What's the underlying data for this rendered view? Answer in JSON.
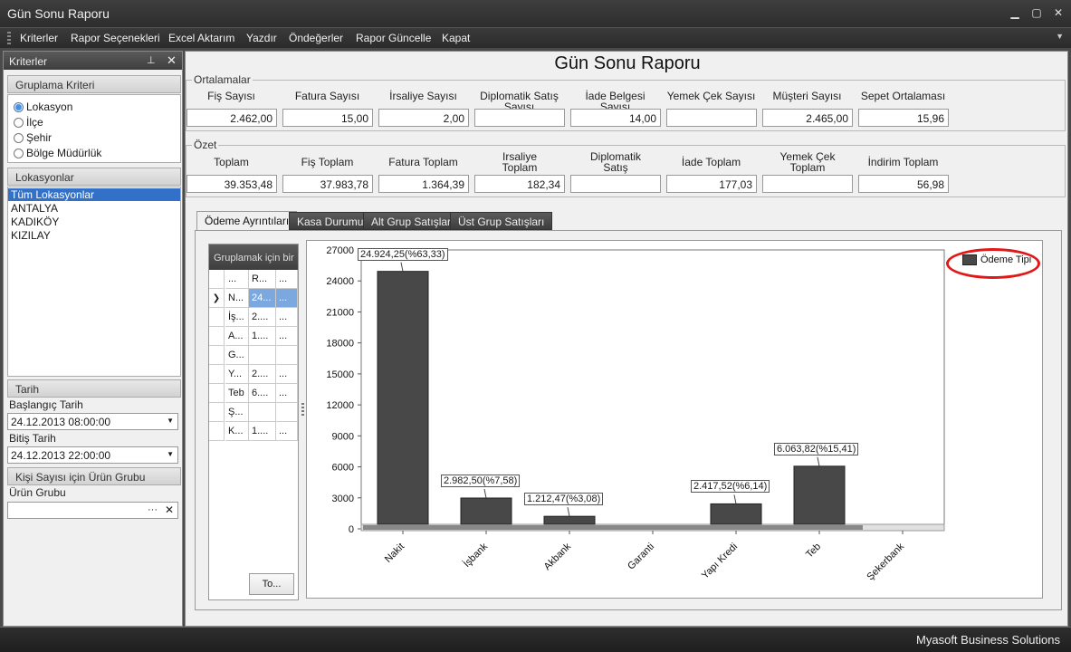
{
  "window": {
    "title": "Gün Sonu Raporu"
  },
  "menu": [
    "Kriterler",
    "Rapor Seçenekleri",
    "Excel Aktarım",
    "Yazdır",
    "Öndeğerler",
    "Rapor Güncelle",
    "Kapat"
  ],
  "left_panel": {
    "header": "Kriterler",
    "grouping": {
      "title": "Gruplama Kriteri",
      "options": [
        "Lokasyon",
        "İlçe",
        "Şehir",
        "Bölge Müdürlük"
      ],
      "selected": "Lokasyon"
    },
    "locations": {
      "title": "Lokasyonlar",
      "items": [
        "Tüm Lokasyonlar",
        "ANTALYA",
        "KADIKÖY",
        "KIZILAY"
      ],
      "selected": "Tüm Lokasyonlar"
    },
    "date": {
      "title": "Tarih",
      "start_label": "Başlangıç Tarih",
      "start_value": "24.12.2013 08:00:00",
      "end_label": "Bitiş Tarih",
      "end_value": "24.12.2013 22:00:00"
    },
    "product_group": {
      "title": "Kişi Sayısı için Ürün Grubu",
      "label": "Ürün Grubu",
      "value": "",
      "ellipsis": "···",
      "clear": "✕"
    }
  },
  "report": {
    "title": "Gün Sonu Raporu",
    "averages": {
      "title": "Ortalamalar",
      "fields": [
        {
          "label": "Fiş Sayısı",
          "value": "2.462,00"
        },
        {
          "label": "Fatura Sayısı",
          "value": "15,00"
        },
        {
          "label": "İrsaliye Sayısı",
          "value": "2,00"
        },
        {
          "label": "Diplomatik Satış Sayısı",
          "value": ""
        },
        {
          "label": "İade Belgesi Sayısı",
          "value": "14,00"
        },
        {
          "label": "Yemek Çek Sayısı",
          "value": ""
        },
        {
          "label": "Müşteri Sayısı",
          "value": "2.465,00"
        },
        {
          "label": "Sepet Ortalaması",
          "value": "15,96"
        }
      ]
    },
    "summary": {
      "title": "Özet",
      "fields": [
        {
          "label": "Toplam",
          "value": "39.353,48"
        },
        {
          "label": "Fiş Toplam",
          "value": "37.983,78"
        },
        {
          "label": "Fatura Toplam",
          "value": "1.364,39"
        },
        {
          "label": "Irsaliye Toplam",
          "value": "182,34"
        },
        {
          "label": "Diplomatik Satış",
          "value": ""
        },
        {
          "label": "İade Toplam",
          "value": "177,03"
        },
        {
          "label": "Yemek Çek Toplam",
          "value": ""
        },
        {
          "label": "İndirim Toplam",
          "value": "56,98"
        }
      ]
    }
  },
  "tabs": [
    "Ödeme Ayrıntıları",
    "Kasa Durumu",
    "Alt Grup Satışları",
    "Üst Grup Satışları"
  ],
  "active_tab": "Ödeme Ayrıntıları",
  "grid": {
    "group_header": "Gruplamak için bir",
    "columns": [
      "...",
      "R...",
      "..."
    ],
    "rows": [
      [
        "N...",
        "24...",
        "..."
      ],
      [
        "İş...",
        "2....",
        "..."
      ],
      [
        "A...",
        "1....",
        "..."
      ],
      [
        "G...",
        "",
        ""
      ],
      [
        "Y...",
        "2....",
        "..."
      ],
      [
        "Teb",
        "6....",
        "..."
      ],
      [
        "Ş...",
        "",
        ""
      ],
      [
        "K...",
        "1....",
        "..."
      ]
    ],
    "selected_row": 0,
    "footer_button": "To..."
  },
  "chart_data": {
    "type": "bar",
    "categories": [
      "Nakit",
      "İşbank",
      "Akbank",
      "Garanti",
      "Yapı Kredi",
      "Teb",
      "Şekerbank"
    ],
    "series": [
      {
        "name": "Ödeme Tipi",
        "values": [
          24924.25,
          2982.5,
          1212.47,
          0,
          2417.52,
          6063.82,
          0
        ]
      }
    ],
    "data_labels": [
      "24.924,25(%63,33)",
      "2.982,50(%7,58)",
      "1.212,47(%3,08)",
      "",
      "2.417,52(%6,14)",
      "6.063,82(%15,41)",
      ""
    ],
    "yticks": [
      "0",
      "3000",
      "6000",
      "9000",
      "12000",
      "15000",
      "18000",
      "21000",
      "24000",
      "27000"
    ],
    "ylim": [
      0,
      27000
    ],
    "legend_position": "top-right",
    "bar_color": "#484848"
  },
  "statusbar": {
    "text": "Myasoft Business Solutions"
  }
}
